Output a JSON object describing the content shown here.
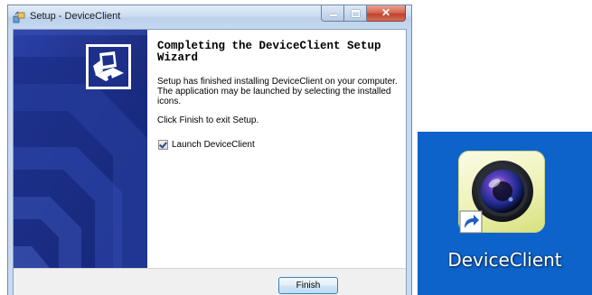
{
  "window": {
    "title": "Setup - DeviceClient",
    "icons": {
      "title": "setup-installer-icon",
      "minimize": "minimize-icon",
      "maximize": "maximize-icon",
      "close": "close-icon"
    }
  },
  "wizard": {
    "heading": "Completing the DeviceClient Setup Wizard",
    "finished_text": "Setup has finished installing DeviceClient on your computer. The application may be launched by selecting the installed icons.",
    "exit_text": "Click Finish to exit Setup.",
    "launch_checkbox": {
      "label": "Launch DeviceClient",
      "checked": true
    },
    "finish_button": "Finish",
    "side_image": "computer-installer-icon"
  },
  "desktop": {
    "shortcut_label": "DeviceClient",
    "icon": "camera-lens-icon",
    "overlay_icon": "shortcut-arrow-icon"
  },
  "colors": {
    "side_panel": "#1c2f8a",
    "desktop_background": "#0d63c9",
    "close_button": "#c9503a"
  }
}
